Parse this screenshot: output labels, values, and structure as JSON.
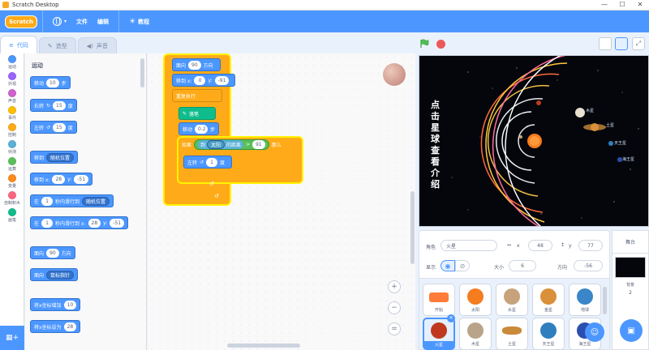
{
  "window": {
    "title": "Scratch Desktop",
    "controls": [
      "—",
      "☐",
      "✕"
    ]
  },
  "menubar": {
    "logo_text": "Scratch",
    "items": [
      {
        "label": "文件"
      },
      {
        "label": "编辑"
      },
      {
        "label": "教程"
      }
    ]
  },
  "tabs": [
    {
      "label": "代码",
      "active": true
    },
    {
      "label": "造型",
      "active": false
    },
    {
      "label": "声音",
      "active": false
    }
  ],
  "categories": [
    {
      "label": "运动",
      "color": "#4c97ff"
    },
    {
      "label": "外观",
      "color": "#9966ff"
    },
    {
      "label": "声音",
      "color": "#cf63cf"
    },
    {
      "label": "事件",
      "color": "#ffbf00"
    },
    {
      "label": "控制",
      "color": "#ffab19"
    },
    {
      "label": "侦测",
      "color": "#5cb1d6"
    },
    {
      "label": "运算",
      "color": "#59c059"
    },
    {
      "label": "变量",
      "color": "#ff8c1a"
    },
    {
      "label": "自制积木",
      "color": "#ff6680"
    },
    {
      "label": "画笔",
      "color": "#0fbd8c"
    }
  ],
  "palette": {
    "section": "运动",
    "blocks": [
      {
        "text": "移动",
        "val": "10",
        "suffix": "步"
      },
      {
        "text": "右转",
        "val": "15",
        "suffix": "度",
        "icon": "↻"
      },
      {
        "text": "左转",
        "val": "15",
        "suffix": "度",
        "icon": "↺"
      },
      {
        "text": "移到",
        "dd": "随机位置"
      },
      {
        "text": "移到 x:",
        "val": "28",
        "mid": "y:",
        "val2": "-51"
      },
      {
        "text": "在",
        "val": "1",
        "mid": "秒内滑行到",
        "dd": "随机位置"
      },
      {
        "text": "在",
        "val": "1",
        "mid": "秒内滑行到 x:",
        "val2": "28",
        "mid2": "y:",
        "val3": "-51"
      },
      {
        "text": "面向",
        "val": "90",
        "suffix": "方向"
      },
      {
        "text": "面向",
        "dd": "鼠标指针"
      },
      {
        "text": "将x坐标增加",
        "val": "10"
      },
      {
        "text": "将x坐标设为",
        "val": "28"
      }
    ]
  },
  "script": {
    "b1": {
      "text": "面向",
      "val": "90",
      "suffix": "方向"
    },
    "b2": {
      "text": "移到 x:",
      "val": "0",
      "mid": "y:",
      "val2": "-91"
    },
    "b3": {
      "text": "重复执行"
    },
    "b4": {
      "text": "落笔"
    },
    "b5": {
      "text": "移动",
      "val": "0.2",
      "suffix": "步"
    },
    "b6": {
      "text": "如果",
      "op1": "到",
      "op2": "太阳",
      "op3": "的距离",
      "op4": ">",
      "val": "91",
      "suffix": "那么"
    },
    "b7": {
      "text": "左转",
      "val": "1",
      "suffix": "度"
    }
  },
  "stage": {
    "vertical_text": "点击星球查看介绍",
    "labels": [
      "木星",
      "土星",
      "天王星",
      "海王星"
    ]
  },
  "sprite_info": {
    "sprite_label": "角色",
    "sprite_name": "火星",
    "x_label": "x",
    "x_value": "48",
    "y_label": "y",
    "y_value": "77",
    "show_label": "显示",
    "size_label": "大小",
    "size_value": "6",
    "direction_label": "方向",
    "direction_value": "-56"
  },
  "sprites": [
    {
      "name": "开始",
      "color": "#ff7b39"
    },
    {
      "name": "太阳",
      "color": "#f57c1f"
    },
    {
      "name": "水星",
      "color": "#c7a27a"
    },
    {
      "name": "金星",
      "color": "#d9903a"
    },
    {
      "name": "地球",
      "color": "#3a86c8"
    },
    {
      "name": "火星",
      "color": "#c0391e",
      "selected": true
    },
    {
      "name": "木星",
      "color": "#b9a48a"
    },
    {
      "name": "土星",
      "color": "#c98a3a"
    },
    {
      "name": "天王星",
      "color": "#2f7fbf"
    },
    {
      "name": "海王星",
      "color": "#2a4fae"
    }
  ],
  "stage_pane": {
    "title": "舞台",
    "backdrops_label": "背景",
    "backdrops_count": "2"
  }
}
